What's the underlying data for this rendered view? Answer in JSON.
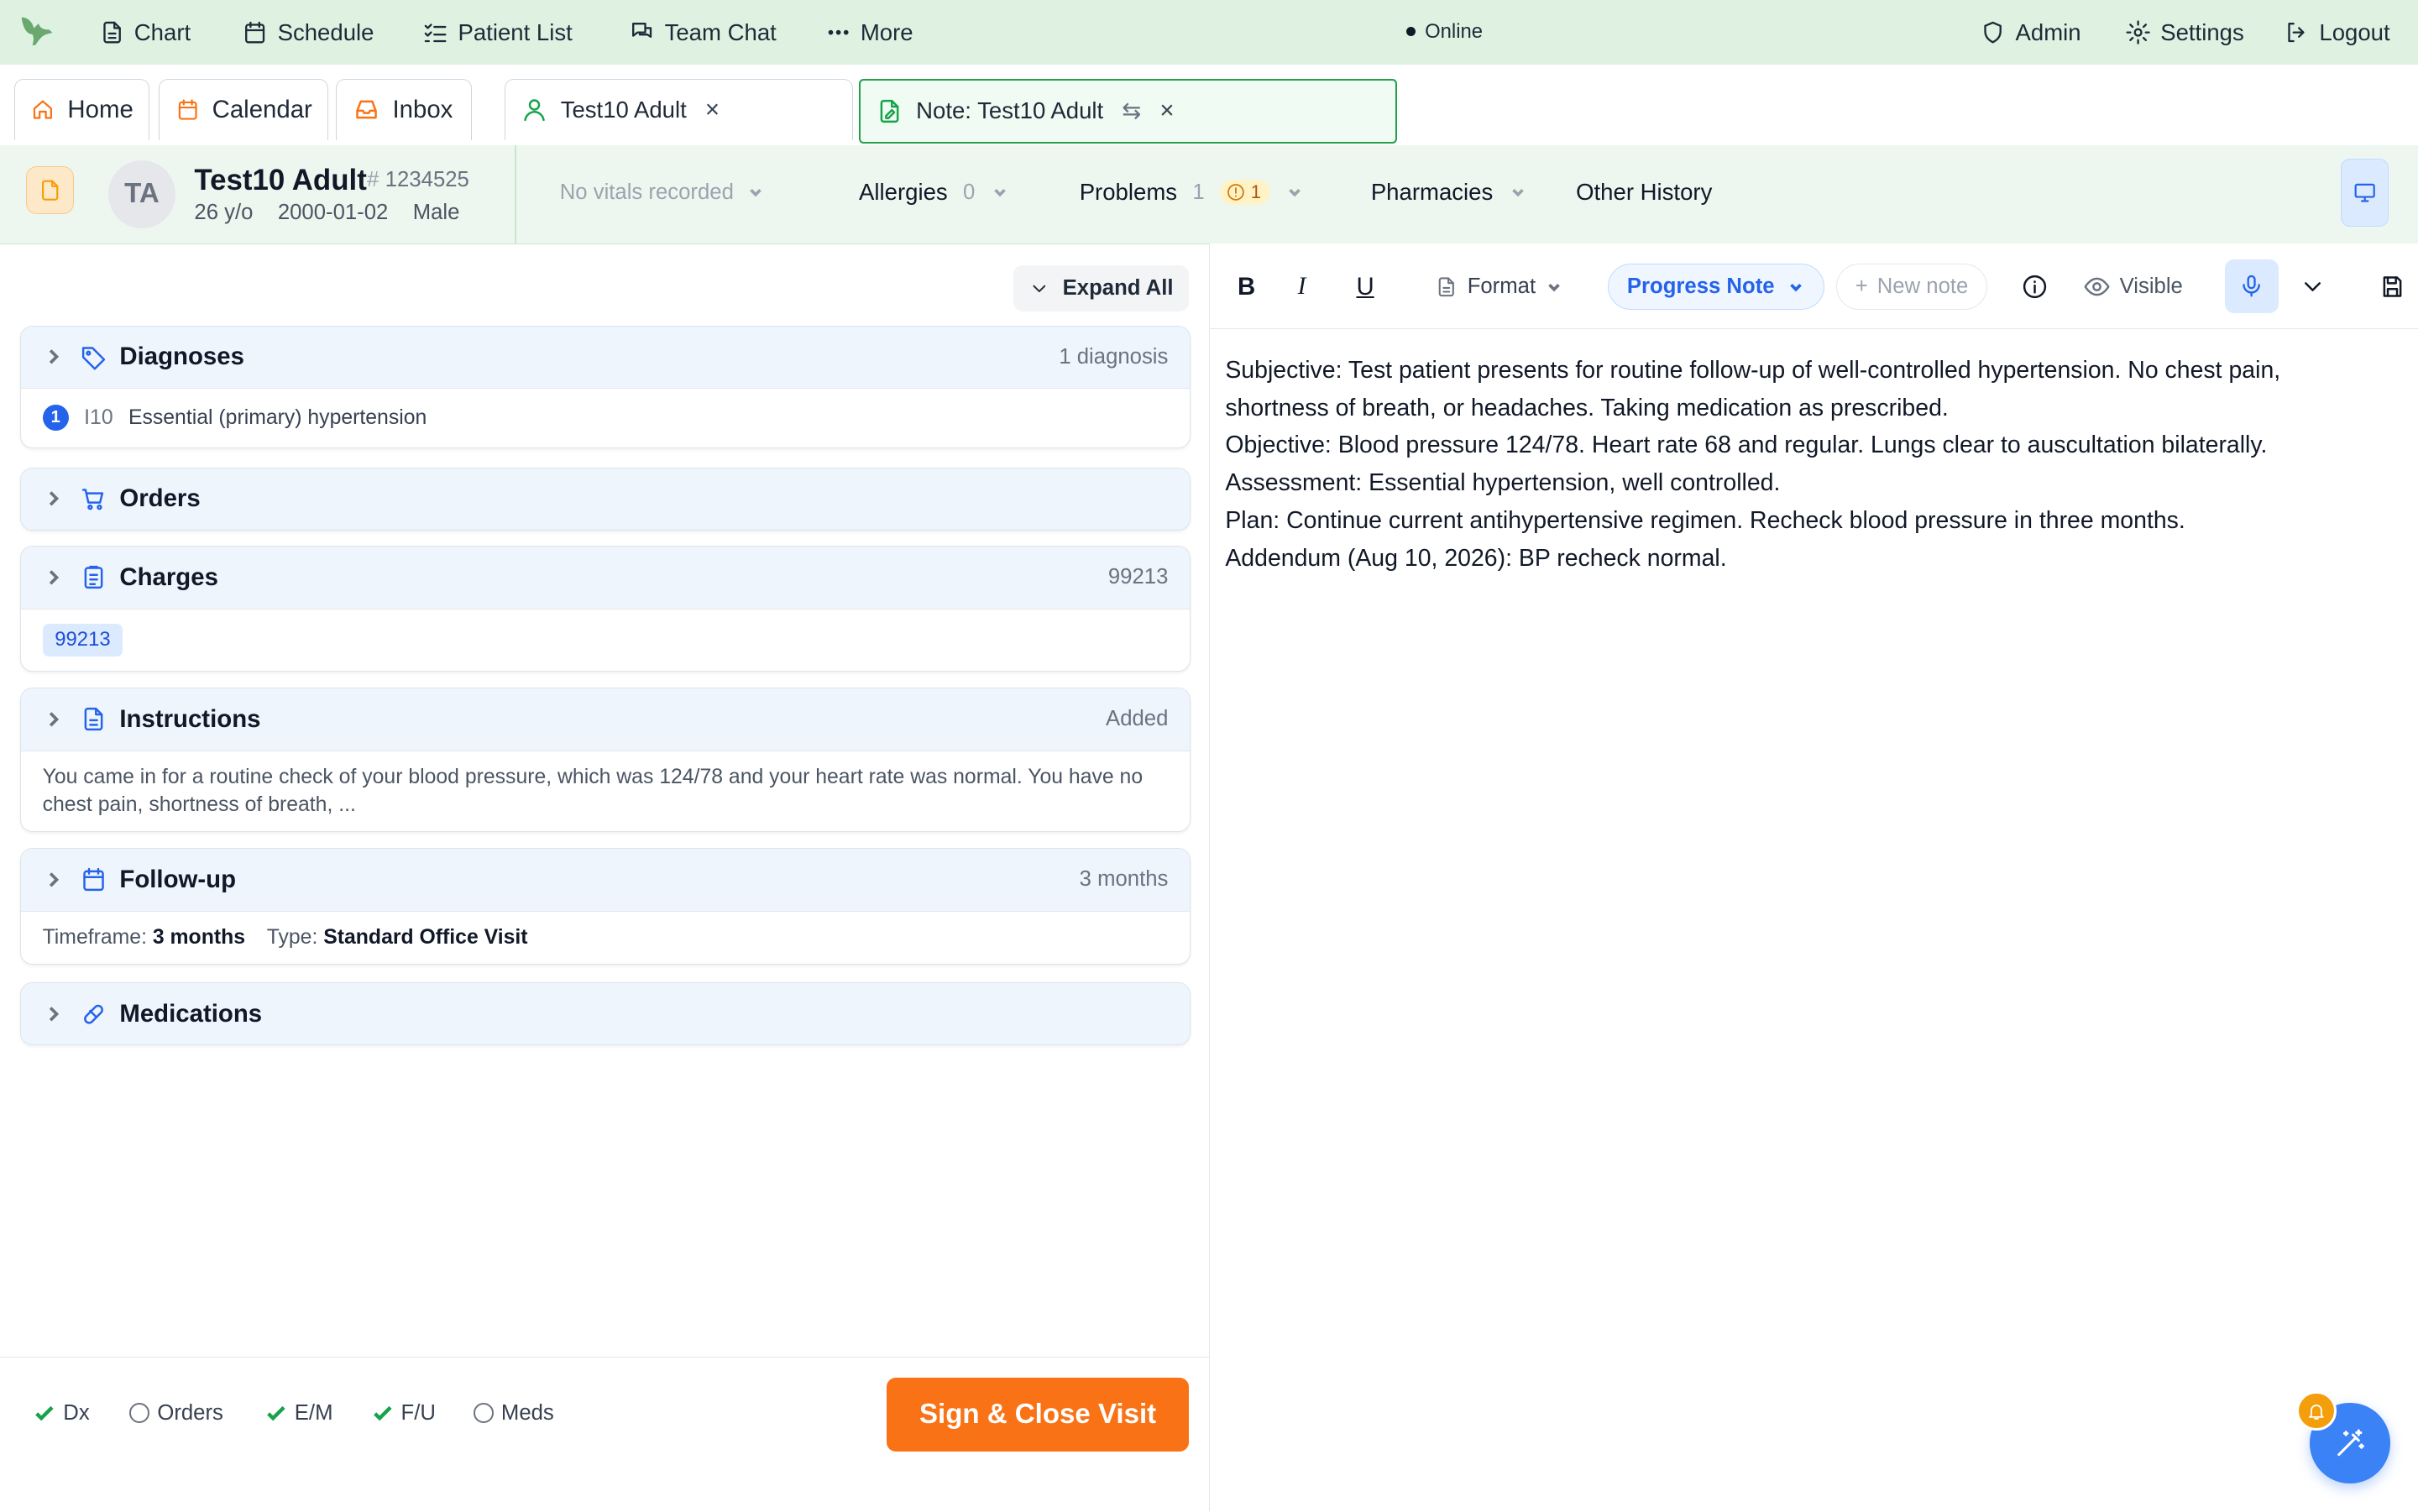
{
  "colors": {
    "accent": "#16a34a",
    "brand_orange": "#f97316",
    "link_blue": "#2563eb",
    "nav_bg": "#dff2e2"
  },
  "topnav": {
    "items": [
      "Chart",
      "Schedule",
      "Patient List",
      "Team Chat",
      "More"
    ],
    "status": "Online",
    "right_items": [
      "Admin",
      "Settings",
      "Logout"
    ]
  },
  "tabs": {
    "home": "Home",
    "calendar": "Calendar",
    "inbox": "Inbox",
    "patient_tab": "Test10 Adult",
    "note_tab": "Note: Test10 Adult",
    "close_symbol": "×",
    "swap_symbol": "⇆"
  },
  "patient": {
    "initials": "TA",
    "name": "Test10 Adult",
    "mrn_hash": "#",
    "mrn": "1234525",
    "age": "26 y/o",
    "dob": "2000-01-02",
    "sex": "Male",
    "vitals": "No vitals recorded",
    "allergies_label": "Allergies",
    "allergies_count": "0",
    "problems_label": "Problems",
    "problems_count": "1",
    "problems_alert": "1",
    "pharmacies_label": "Pharmacies",
    "other_history_label": "Other History"
  },
  "left": {
    "expand_all": "Expand All",
    "diagnoses": {
      "title": "Diagnoses",
      "meta": "1 diagnosis",
      "items": [
        {
          "num": "1",
          "code": "I10",
          "desc": "Essential (primary) hypertension"
        }
      ]
    },
    "orders": {
      "title": "Orders"
    },
    "charges": {
      "title": "Charges",
      "meta": "99213",
      "chip": "99213"
    },
    "instructions": {
      "title": "Instructions",
      "meta": "Added",
      "text": "You came in for a routine check of your blood pressure, which was 124/78 and your heart rate was normal. You have no chest pain, shortness of breath, ..."
    },
    "followup": {
      "title": "Follow-up",
      "meta": "3 months",
      "timeframe_label": "Timeframe:",
      "timeframe": "3 months",
      "type_label": "Type:",
      "type": "Standard Office Visit"
    },
    "medications": {
      "title": "Medications"
    }
  },
  "checklist": [
    {
      "label": "Dx",
      "done": true
    },
    {
      "label": "Orders",
      "done": false
    },
    {
      "label": "E/M",
      "done": true
    },
    {
      "label": "F/U",
      "done": true
    },
    {
      "label": "Meds",
      "done": false
    }
  ],
  "sign_button": "Sign & Close Visit",
  "editor": {
    "bold": "B",
    "italic": "I",
    "underline": "U",
    "format": "Format",
    "note_type": "Progress Note",
    "new_note": "New note",
    "visibility": "Visible",
    "note_lines": [
      "Subjective: Test patient presents for routine follow-up of well-controlled hypertension. No chest pain, shortness of breath, or headaches. Taking medication as prescribed.",
      "Objective: Blood pressure 124/78. Heart rate 68 and regular. Lungs clear to auscultation bilaterally.",
      "Assessment: Essential hypertension, well controlled.",
      "Plan: Continue current antihypertensive regimen. Recheck blood pressure in three months.",
      "Addendum (Aug 10, 2026): BP recheck normal."
    ]
  },
  "icons": {
    "nav": [
      "file-icon",
      "calendar-icon",
      "list-check-icon",
      "chat-icon",
      "more-dots-icon"
    ],
    "right": [
      "shield-icon",
      "gear-icon",
      "logout-icon"
    ]
  }
}
